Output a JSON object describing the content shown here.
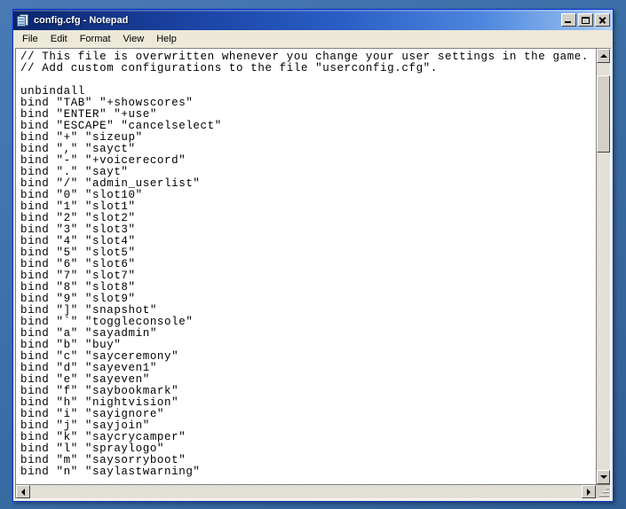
{
  "window": {
    "title": "config.cfg - Notepad",
    "icon": "notepad-document-icon",
    "colors": {
      "titlebar_start": "#0a246a",
      "titlebar_end": "#b9d4f5",
      "window_face": "#ece9d8",
      "desktop": "#3a6ea5",
      "text_bg": "#ffffff",
      "text_fg": "#000000"
    },
    "buttons": {
      "minimize": "Minimize",
      "maximize": "Maximize",
      "close": "Close"
    }
  },
  "menubar": {
    "items": [
      {
        "label": "File"
      },
      {
        "label": "Edit"
      },
      {
        "label": "Format"
      },
      {
        "label": "View"
      },
      {
        "label": "Help"
      }
    ]
  },
  "editor": {
    "filename": "config.cfg",
    "content": "// This file is overwritten whenever you change your user settings in the game.\n// Add custom configurations to the file \"userconfig.cfg\".\n\nunbindall\nbind \"TAB\" \"+showscores\"\nbind \"ENTER\" \"+use\"\nbind \"ESCAPE\" \"cancelselect\"\nbind \"+\" \"sizeup\"\nbind \",\" \"sayct\"\nbind \"-\" \"+voicerecord\"\nbind \".\" \"sayt\"\nbind \"/\" \"admin_userlist\"\nbind \"0\" \"slot10\"\nbind \"1\" \"slot1\"\nbind \"2\" \"slot2\"\nbind \"3\" \"slot3\"\nbind \"4\" \"slot4\"\nbind \"5\" \"slot5\"\nbind \"6\" \"slot6\"\nbind \"7\" \"slot7\"\nbind \"8\" \"slot8\"\nbind \"9\" \"slot9\"\nbind \"]\" \"snapshot\"\nbind \"`\" \"toggleconsole\"\nbind \"a\" \"sayadmin\"\nbind \"b\" \"buy\"\nbind \"c\" \"sayceremony\"\nbind \"d\" \"sayeven1\"\nbind \"e\" \"sayeven\"\nbind \"f\" \"saybookmark\"\nbind \"h\" \"nightvision\"\nbind \"i\" \"sayignore\"\nbind \"j\" \"sayjoin\"\nbind \"k\" \"saycrycamper\"\nbind \"l\" \"spraylogo\"\nbind \"m\" \"saysorryboot\"\nbind \"n\" \"saylastwarning\""
  },
  "scrollbars": {
    "vertical": {
      "up_arrow": "scroll-up",
      "down_arrow": "scroll-down",
      "thumb_position_percent": 3,
      "thumb_size_percent": 19
    },
    "horizontal": {
      "left_arrow": "scroll-left",
      "right_arrow": "scroll-right"
    },
    "size_grip": "resize-grip"
  }
}
